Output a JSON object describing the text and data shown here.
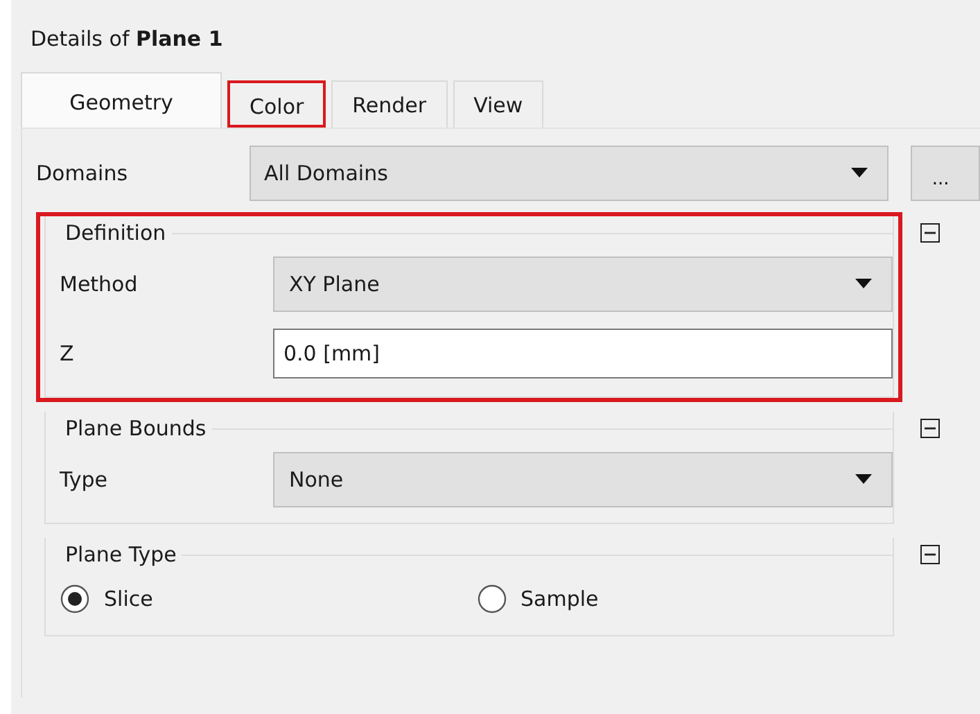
{
  "title": {
    "prefix": "Details of",
    "name": "Plane 1"
  },
  "tabs": [
    {
      "label": "Geometry",
      "selected": true,
      "highlighted": false
    },
    {
      "label": "Color",
      "selected": false,
      "highlighted": true
    },
    {
      "label": "Render",
      "selected": false,
      "highlighted": false
    },
    {
      "label": "View",
      "selected": false,
      "highlighted": false
    }
  ],
  "domains": {
    "label": "Domains",
    "value": "All Domains",
    "button": "..."
  },
  "groups": [
    {
      "title": "Definition",
      "expanded": true,
      "highlighted": true,
      "rows": [
        {
          "kind": "dropdown",
          "label": "Method",
          "value": "XY Plane"
        },
        {
          "kind": "text",
          "label": "Z",
          "value": "0.0 [mm]"
        }
      ]
    },
    {
      "title": "Plane Bounds",
      "expanded": true,
      "highlighted": false,
      "rows": [
        {
          "kind": "dropdown",
          "label": "Type",
          "value": "None"
        }
      ]
    },
    {
      "title": "Plane Type",
      "expanded": true,
      "highlighted": false,
      "rows": [
        {
          "kind": "radios",
          "options": [
            {
              "label": "Slice",
              "selected": true
            },
            {
              "label": "Sample",
              "selected": false
            }
          ]
        }
      ]
    }
  ]
}
